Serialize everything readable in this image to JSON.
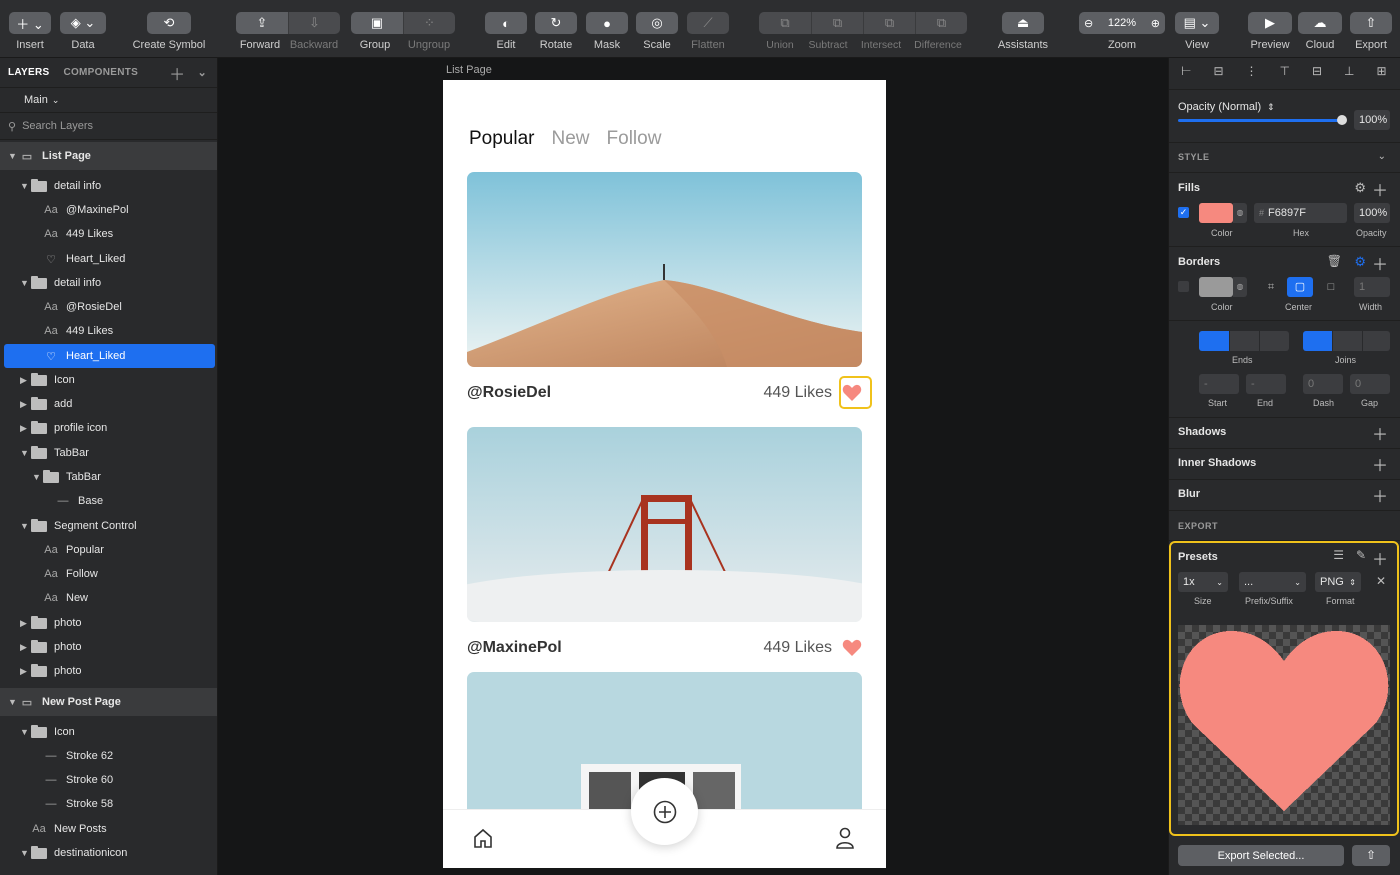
{
  "toolbar": {
    "insert": "Insert",
    "data": "Data",
    "create_symbol": "Create Symbol",
    "forward": "Forward",
    "backward": "Backward",
    "group": "Group",
    "ungroup": "Ungroup",
    "edit": "Edit",
    "rotate": "Rotate",
    "mask": "Mask",
    "scale": "Scale",
    "flatten": "Flatten",
    "union": "Union",
    "subtract": "Subtract",
    "intersect": "Intersect",
    "difference": "Difference",
    "assistants": "Assistants",
    "zoom_value": "122%",
    "zoom": "Zoom",
    "view": "View",
    "preview": "Preview",
    "cloud": "Cloud",
    "export": "Export"
  },
  "left_panel": {
    "tab_layers": "LAYERS",
    "tab_components": "COMPONENTS",
    "page_selector": "Main",
    "search_placeholder": "Search Layers",
    "layers": [
      {
        "name": "List Page",
        "type": "page"
      },
      {
        "name": "detail info",
        "type": "folder"
      },
      {
        "name": "@MaxinePol",
        "type": "text"
      },
      {
        "name": "449 Likes",
        "type": "text"
      },
      {
        "name": "Heart_Liked",
        "type": "shape"
      },
      {
        "name": "detail info",
        "type": "folder"
      },
      {
        "name": "@RosieDel",
        "type": "text"
      },
      {
        "name": "449 Likes",
        "type": "text"
      },
      {
        "name": "Heart_Liked",
        "type": "shape",
        "selected": true
      },
      {
        "name": "Icon",
        "type": "folder"
      },
      {
        "name": "add",
        "type": "folder"
      },
      {
        "name": "profile icon",
        "type": "folder"
      },
      {
        "name": "TabBar",
        "type": "folder"
      },
      {
        "name": "TabBar",
        "type": "folder"
      },
      {
        "name": "Base",
        "type": "line"
      },
      {
        "name": "Segment Control",
        "type": "folder"
      },
      {
        "name": "Popular",
        "type": "text"
      },
      {
        "name": "Follow",
        "type": "text"
      },
      {
        "name": "New",
        "type": "text"
      },
      {
        "name": "photo",
        "type": "folder"
      },
      {
        "name": "photo",
        "type": "folder"
      },
      {
        "name": "photo",
        "type": "folder"
      },
      {
        "name": "New Post Page",
        "type": "page"
      },
      {
        "name": "Icon",
        "type": "folder"
      },
      {
        "name": "Stroke 62",
        "type": "line"
      },
      {
        "name": "Stroke 60",
        "type": "line"
      },
      {
        "name": "Stroke 58",
        "type": "line"
      },
      {
        "name": "New Posts",
        "type": "text"
      },
      {
        "name": "destinationicon",
        "type": "folder"
      }
    ]
  },
  "canvas": {
    "artboard_label": "List Page",
    "segments": [
      "Popular",
      "New",
      "Follow"
    ],
    "posts": [
      {
        "user": "@RosieDel",
        "likes": "449 Likes"
      },
      {
        "user": "@MaxinePol",
        "likes": "449 Likes"
      }
    ]
  },
  "inspector": {
    "opacity_label": "Opacity (Normal)",
    "opacity_value": "100%",
    "style_header": "STYLE",
    "fills": "Fills",
    "fill_hex": "F6897F",
    "fill_opacity": "100%",
    "color_label": "Color",
    "hex_label": "Hex",
    "opacity_col_label": "Opacity",
    "borders": "Borders",
    "center_label": "Center",
    "width_label": "Width",
    "ends_label": "Ends",
    "joins_label": "Joins",
    "start_label": "Start",
    "end_label": "End",
    "dash_label": "Dash",
    "gap_label": "Gap",
    "border_width": "1",
    "dash_value": "0",
    "gap_value": "0",
    "shadows": "Shadows",
    "inner_shadows": "Inner Shadows",
    "blur": "Blur",
    "export_header": "EXPORT",
    "presets": "Presets",
    "size_value": "1x",
    "prefix_value": "...",
    "format_value": "PNG",
    "size_label": "Size",
    "prefix_label": "Prefix/Suffix",
    "format_label": "Format",
    "export_selected": "Export Selected..."
  },
  "colors": {
    "accent": "#1E6FF0",
    "fill": "#F6897F",
    "highlight": "#F0C21B"
  }
}
